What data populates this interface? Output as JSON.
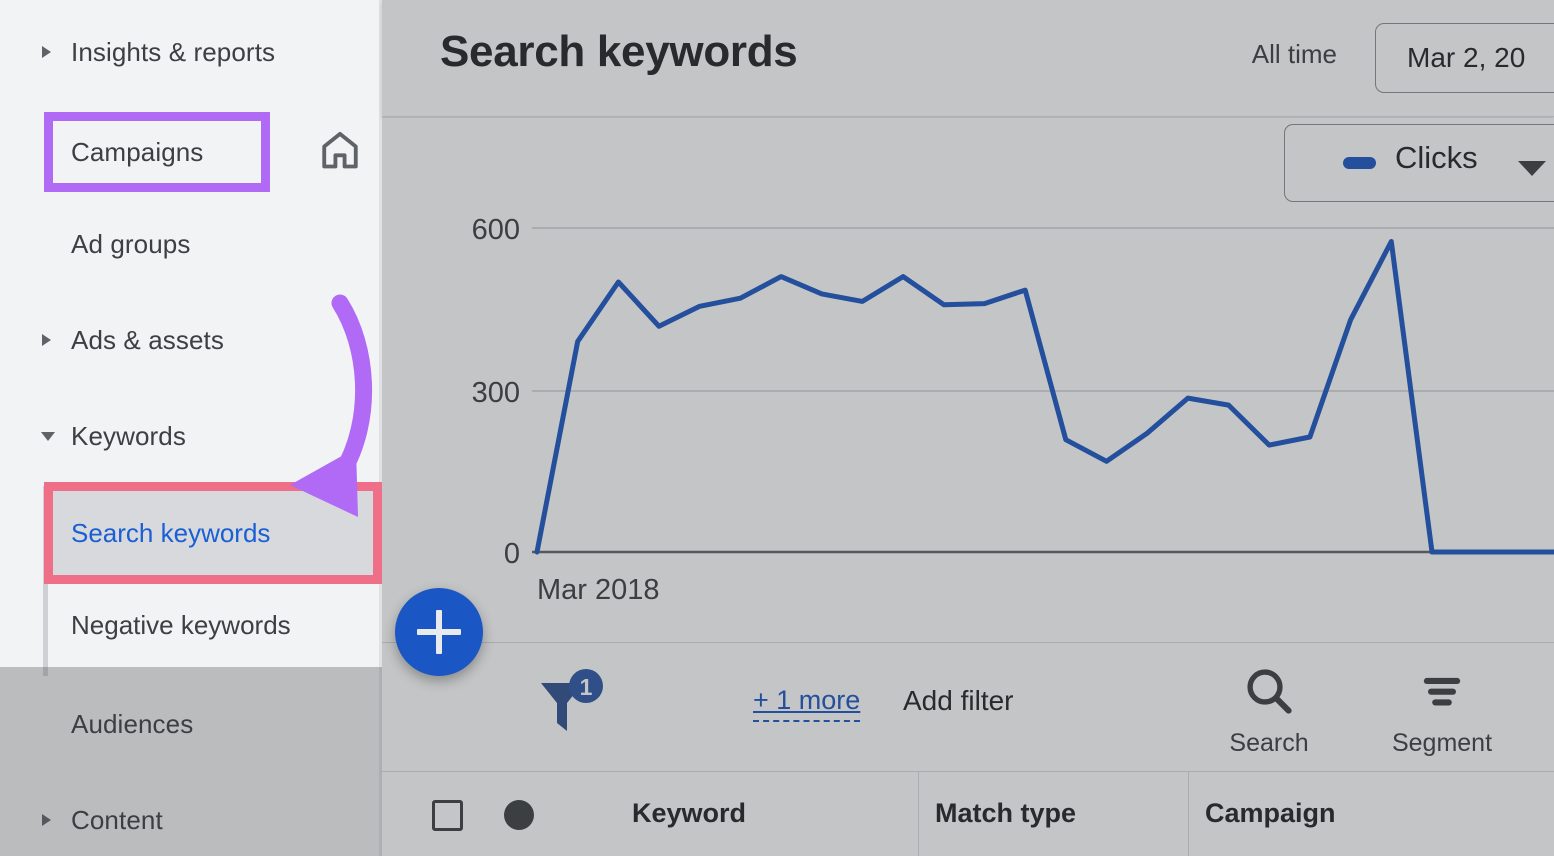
{
  "sidebar": {
    "items": [
      {
        "label": "Insights & reports",
        "caret": "collapsed",
        "icon": "chevron-right-icon"
      },
      {
        "label": "Campaigns",
        "caret": "none",
        "icon": "home-icon"
      },
      {
        "label": "Ad groups",
        "caret": "none"
      },
      {
        "label": "Ads & assets",
        "caret": "collapsed",
        "icon": "chevron-right-icon"
      },
      {
        "label": "Keywords",
        "caret": "expanded",
        "icon": "chevron-down-icon"
      },
      {
        "label": "Search keywords",
        "state": "selected"
      },
      {
        "label": "Negative keywords"
      },
      {
        "label": "Audiences"
      },
      {
        "label": "Content",
        "caret": "collapsed",
        "icon": "chevron-right-icon"
      }
    ],
    "home_icon": "home-icon"
  },
  "header": {
    "title": "Search keywords",
    "range_label": "All time",
    "date_value": "Mar 2, 20"
  },
  "chart_panel": {
    "metric_label": "Clicks",
    "metric_caret": "chevron-down-icon",
    "legend_swatch_color": "#1a56c4"
  },
  "chart_data": {
    "type": "line",
    "title": "Clicks",
    "xlabel": "",
    "ylabel": "",
    "ylim": [
      0,
      700
    ],
    "yticks": [
      0,
      300,
      600
    ],
    "ytick_labels": [
      "0",
      "300",
      "600"
    ],
    "xtick_labels": [
      "Mar 2018"
    ],
    "grid": true,
    "legend": [
      "Clicks"
    ],
    "series": [
      {
        "name": "Clicks",
        "color": "#1a56c4",
        "values": [
          0,
          390,
          500,
          418,
          455,
          470,
          510,
          478,
          464,
          510,
          458,
          460,
          485,
          208,
          168,
          220,
          285,
          272,
          198,
          213,
          430,
          575,
          0,
          0,
          0,
          0
        ]
      }
    ]
  },
  "filter_bar": {
    "filter_icon": "filter-funnel-icon",
    "filter_badge_count": "1",
    "more_link": "+ 1 more",
    "add_filter_label": "Add filter",
    "tools": [
      {
        "label": "Search",
        "icon": "search-icon"
      },
      {
        "label": "Segment",
        "icon": "segment-icon"
      }
    ]
  },
  "table": {
    "columns": [
      "Keyword",
      "Match type",
      "Campaign"
    ],
    "select_all_checkbox": "unchecked",
    "status_icon": "status-dot-icon"
  },
  "fab": {
    "icon": "plus-icon",
    "color": "#1a56c4"
  },
  "annotations": {
    "campaigns_highlight_color": "#b06af5",
    "search_keywords_highlight_color": "#ef6e88",
    "arrow_color": "#b06af5"
  }
}
